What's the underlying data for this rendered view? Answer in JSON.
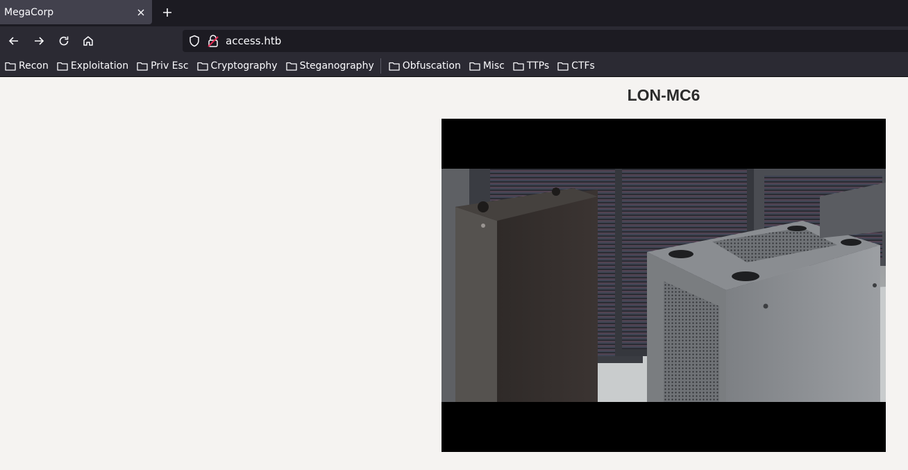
{
  "browser": {
    "tab_title": "MegaCorp",
    "url": "access.htb",
    "bookmarks": [
      "Recon",
      "Exploitation",
      "Priv Esc",
      "Cryptography",
      "Steganography",
      "Obfuscation",
      "Misc",
      "TTPs",
      "CTFs"
    ]
  },
  "page": {
    "heading": "LON-MC6"
  }
}
